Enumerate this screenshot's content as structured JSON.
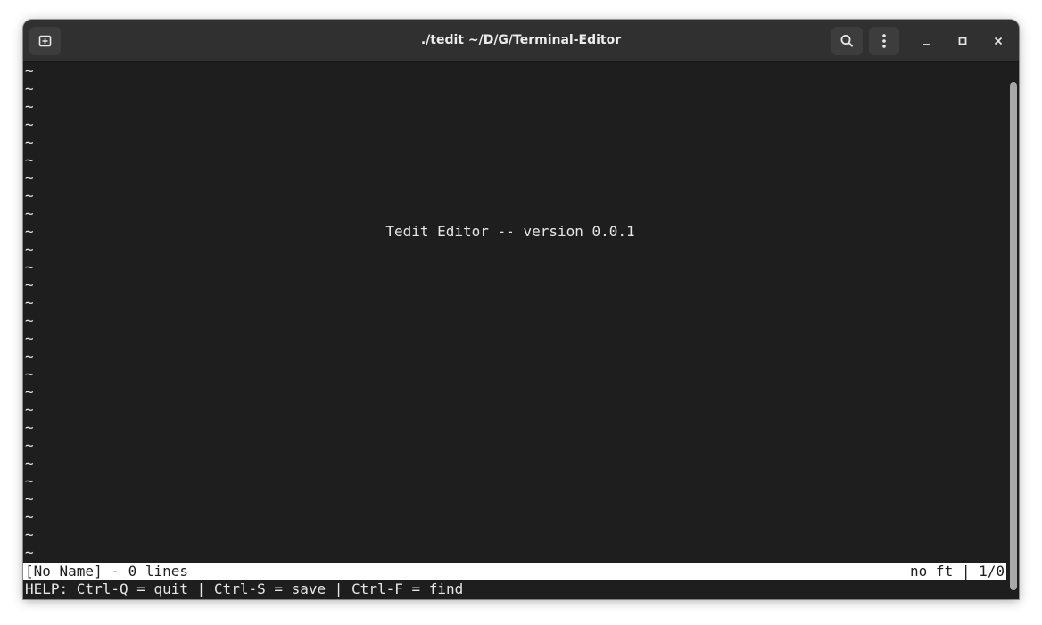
{
  "window": {
    "title": "./tedit ~/D/G/Terminal-Editor"
  },
  "headerbar": {
    "new_tab_icon": "new-tab-icon",
    "search_icon": "search-icon",
    "menu_icon": "kebab-menu-icon",
    "minimize_icon": "minimize-icon",
    "maximize_icon": "maximize-icon",
    "close_icon": "close-icon"
  },
  "editor": {
    "tilde": "~",
    "welcome": "Tedit Editor -- version 0.0.1",
    "status_left": "[No Name] - 0 lines",
    "status_right": "no ft | 1/0",
    "help": "HELP: Ctrl-Q = quit | Ctrl-S = save | Ctrl-F = find"
  },
  "colors": {
    "terminal_bg": "#1e1e1e",
    "headerbar_bg": "#303030",
    "text": "#e6e6e6",
    "status_bg": "#ffffff"
  }
}
